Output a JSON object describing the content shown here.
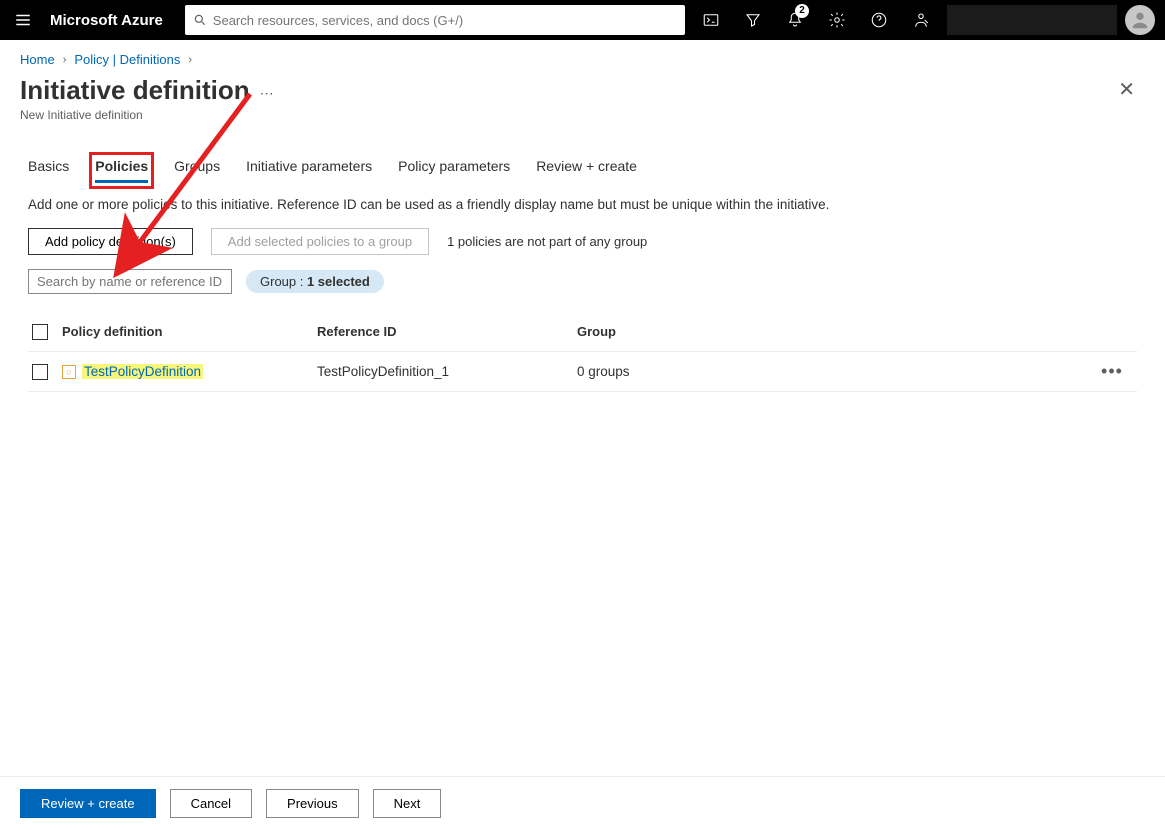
{
  "topbar": {
    "brand": "Microsoft Azure",
    "search_placeholder": "Search resources, services, and docs (G+/)",
    "notification_count": "2"
  },
  "breadcrumb": {
    "items": [
      "Home",
      "Policy | Definitions"
    ]
  },
  "header": {
    "title": "Initiative definition",
    "subtitle": "New Initiative definition"
  },
  "tabs": {
    "items": [
      {
        "label": "Basics"
      },
      {
        "label": "Policies",
        "active": true,
        "boxed": true
      },
      {
        "label": "Groups"
      },
      {
        "label": "Initiative parameters"
      },
      {
        "label": "Policy parameters"
      },
      {
        "label": "Review + create"
      }
    ]
  },
  "description": "Add one or more policies to this initiative. Reference ID can be used as a friendly display name but must be unique within the initiative.",
  "buttons": {
    "add_policy": "Add policy definition(s)",
    "add_to_group": "Add selected policies to a group",
    "status": "1 policies are not part of any group"
  },
  "filter": {
    "search_placeholder": "Search by name or reference ID",
    "group_prefix": "Group : ",
    "group_value": "1 selected"
  },
  "table": {
    "columns": [
      "Policy definition",
      "Reference ID",
      "Group"
    ],
    "rows": [
      {
        "name": "TestPolicyDefinition",
        "ref": "TestPolicyDefinition_1",
        "group": "0 groups"
      }
    ]
  },
  "footer": {
    "review": "Review + create",
    "cancel": "Cancel",
    "previous": "Previous",
    "next": "Next"
  }
}
